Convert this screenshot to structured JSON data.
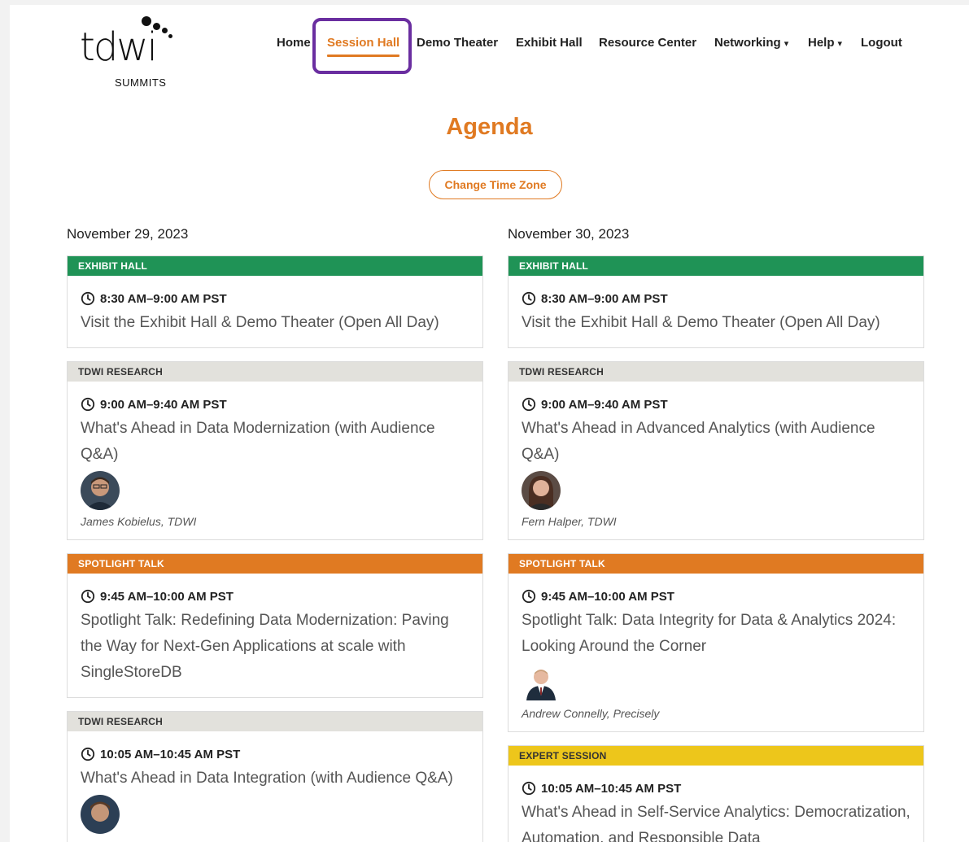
{
  "logo": {
    "wordmark": "tdwi",
    "subtitle": "SUMMITS"
  },
  "nav": [
    {
      "label": "Home",
      "active": false,
      "dropdown": false
    },
    {
      "label": "Session Hall",
      "active": true,
      "dropdown": false
    },
    {
      "label": "Demo Theater",
      "active": false,
      "dropdown": false
    },
    {
      "label": "Exhibit Hall",
      "active": false,
      "dropdown": false
    },
    {
      "label": "Resource Center",
      "active": false,
      "dropdown": false
    },
    {
      "label": "Networking",
      "active": false,
      "dropdown": true
    },
    {
      "label": "Help",
      "active": false,
      "dropdown": true
    },
    {
      "label": "Logout",
      "active": false,
      "dropdown": false
    }
  ],
  "page_title": "Agenda",
  "tz_button_label": "Change Time Zone",
  "days": [
    {
      "date": "November 29, 2023",
      "sessions": [
        {
          "tag": "EXHIBIT HALL",
          "tag_color": "#1f9356",
          "time": "8:30 AM–9:00 AM PST",
          "title": "Visit the Exhibit Hall & Demo Theater (Open All Day)",
          "speaker": ""
        },
        {
          "tag": "TDWI RESEARCH",
          "tag_color": "#e2e1dc",
          "time": "9:00 AM–9:40 AM PST",
          "title": "What's Ahead in Data Modernization (with Audience Q&A)",
          "speaker": "James Kobielus, TDWI"
        },
        {
          "tag": "SPOTLIGHT TALK",
          "tag_color": "#e07a22",
          "time": "9:45 AM–10:00 AM PST",
          "title": "Spotlight Talk: Redefining Data Modernization: Paving the Way for Next-Gen Applications at scale with SingleStoreDB",
          "speaker": ""
        },
        {
          "tag": "TDWI RESEARCH",
          "tag_color": "#e2e1dc",
          "time": "10:05 AM–10:45 AM PST",
          "title": "What's Ahead in Data Integration (with Audience Q&A)",
          "speaker": ""
        }
      ]
    },
    {
      "date": "November 30, 2023",
      "sessions": [
        {
          "tag": "EXHIBIT HALL",
          "tag_color": "#1f9356",
          "time": "8:30 AM–9:00 AM PST",
          "title": "Visit the Exhibit Hall & Demo Theater (Open All Day)",
          "speaker": ""
        },
        {
          "tag": "TDWI RESEARCH",
          "tag_color": "#e2e1dc",
          "time": "9:00 AM–9:40 AM PST",
          "title": "What's Ahead in Advanced Analytics (with Audience Q&A)",
          "speaker": "Fern Halper, TDWI"
        },
        {
          "tag": "SPOTLIGHT TALK",
          "tag_color": "#e07a22",
          "time": "9:45 AM–10:00 AM PST",
          "title": "Spotlight Talk: Data Integrity for Data & Analytics 2024: Looking Around the Corner",
          "speaker": "Andrew Connelly, Precisely"
        },
        {
          "tag": "EXPERT SESSION",
          "tag_color": "#edc61b",
          "time": "10:05 AM–10:45 AM PST",
          "title": "What's Ahead in Self-Service Analytics: Democratization, Automation, and Responsible Data",
          "speaker": ""
        }
      ]
    }
  ]
}
